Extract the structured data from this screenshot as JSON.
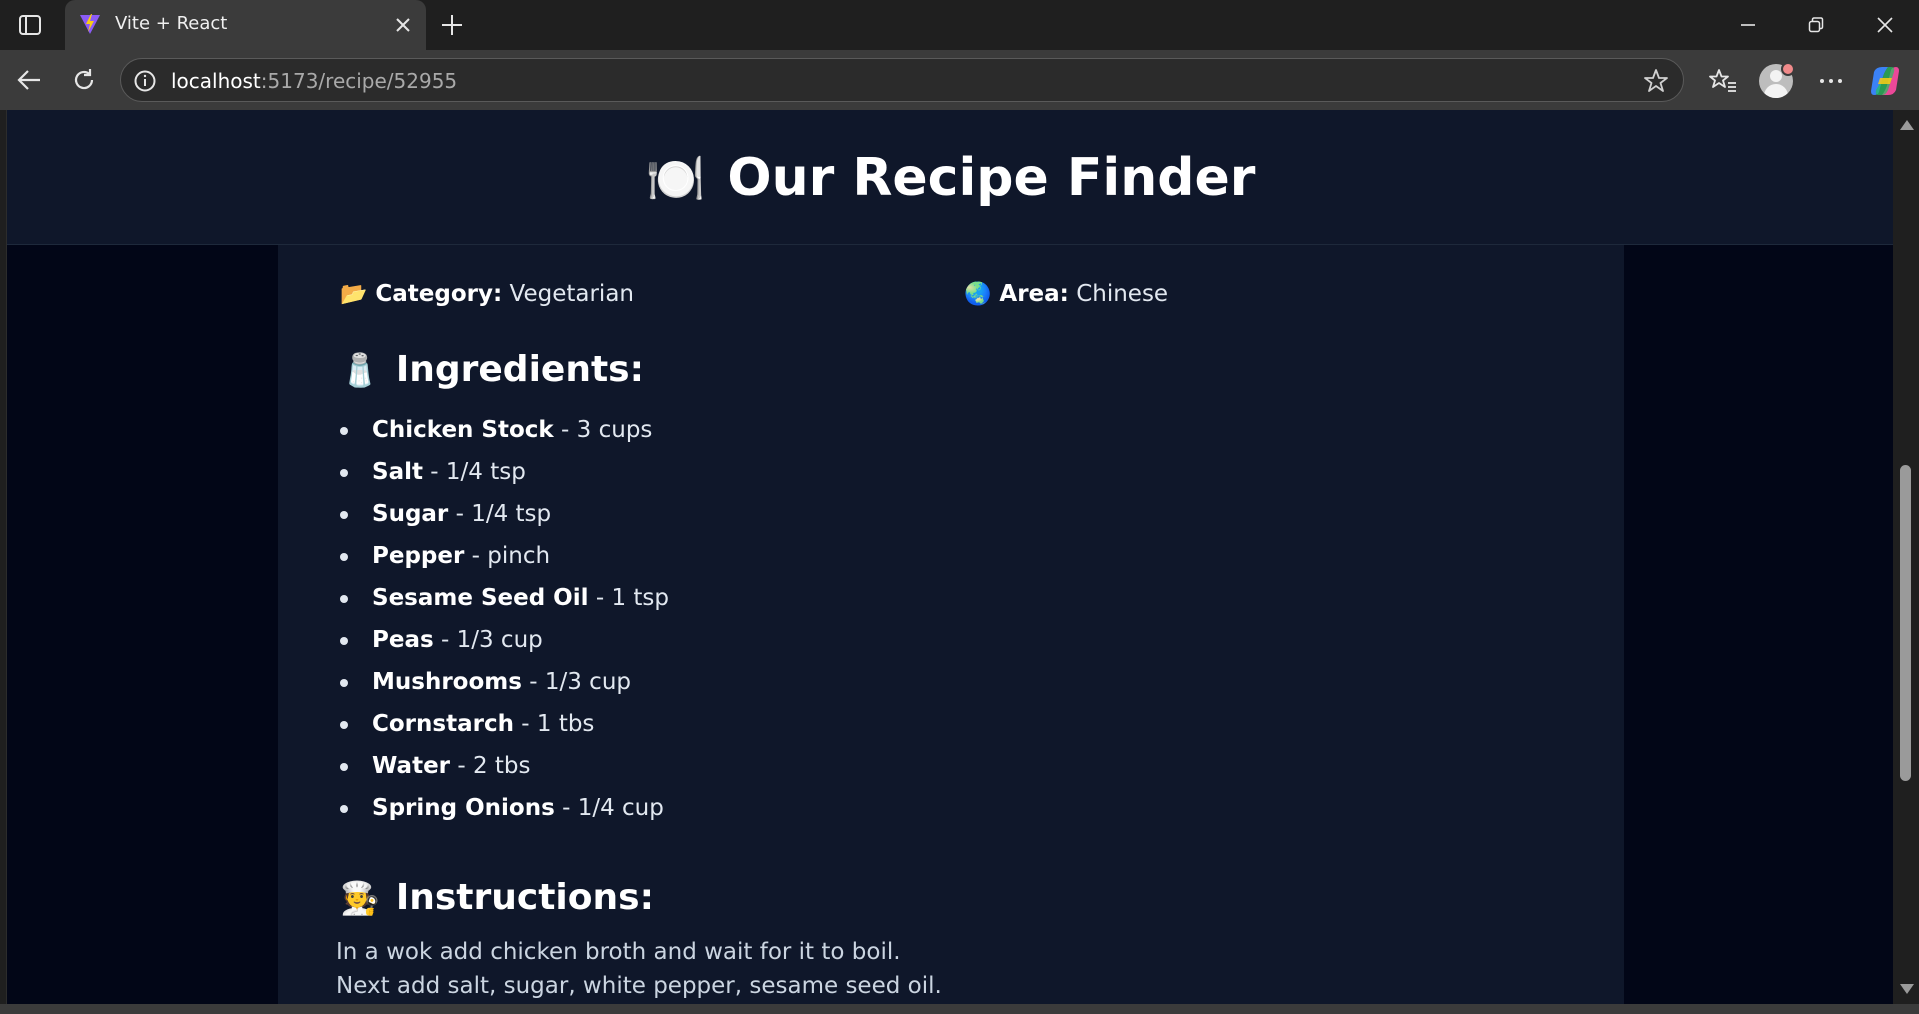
{
  "browser": {
    "tab_title": "Vite + React",
    "url_host": "localhost",
    "url_path": ":5173/recipe/52955"
  },
  "page": {
    "title_emoji": "🍽️",
    "title": "Our Recipe Finder",
    "category_emoji": "📂",
    "category_label": "Category:",
    "category_value": "Vegetarian",
    "area_emoji": "🌏",
    "area_label": "Area:",
    "area_value": "Chinese",
    "ingredients_emoji": "🧂",
    "ingredients_heading": "Ingredients:",
    "ingredients": [
      {
        "name": "Chicken Stock",
        "measure": "3 cups"
      },
      {
        "name": "Salt",
        "measure": "1/4 tsp"
      },
      {
        "name": "Sugar",
        "measure": "1/4 tsp"
      },
      {
        "name": "Pepper",
        "measure": "pinch"
      },
      {
        "name": "Sesame Seed Oil",
        "measure": "1 tsp"
      },
      {
        "name": "Peas",
        "measure": "1/3 cup"
      },
      {
        "name": "Mushrooms",
        "measure": "1/3 cup"
      },
      {
        "name": "Cornstarch",
        "measure": "1 tbs"
      },
      {
        "name": "Water",
        "measure": "2 tbs"
      },
      {
        "name": "Spring Onions",
        "measure": "1/4 cup"
      }
    ],
    "instructions_emoji": "🧑‍🍳",
    "instructions_heading": "Instructions:",
    "instructions": [
      "In a wok add chicken broth and wait for it to boil.",
      "Next add salt, sugar, white pepper, sesame seed oil."
    ]
  }
}
